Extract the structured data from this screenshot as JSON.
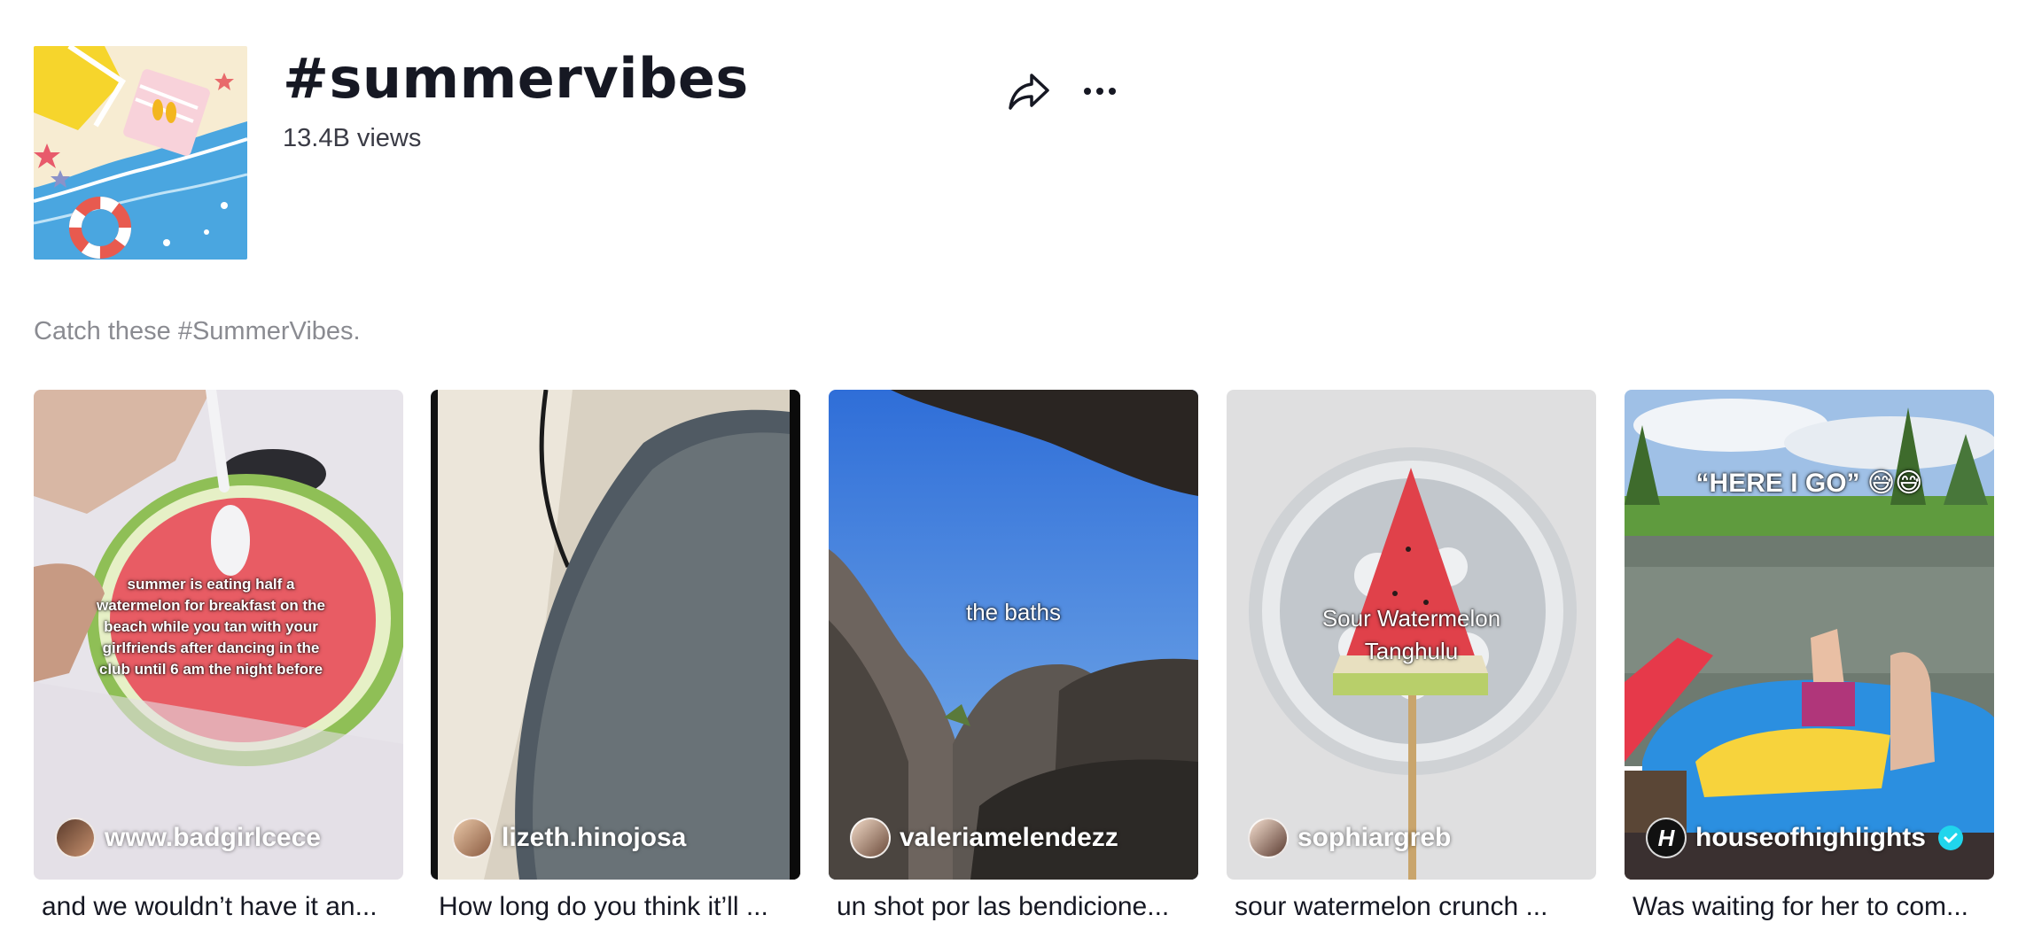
{
  "hashtag": {
    "title": "#summervibes",
    "views": "13.4B views",
    "description": "Catch these #SummerVibes.",
    "cover_icon": "beach-illustration"
  },
  "actions": {
    "share_icon": "share-arrow-icon",
    "more_icon": "ellipsis-icon"
  },
  "videos": [
    {
      "overlay": "summer is eating half a watermelon for breakfast on the beach while you tan with your girlfriends after dancing in the club until 6 am the night before",
      "author": "www.badgirlcece",
      "caption": "and we wouldn’t have it an...",
      "verified": false
    },
    {
      "overlay": "",
      "author": "lizeth.hinojosa",
      "caption": "How long do you think it’ll ...",
      "verified": false
    },
    {
      "overlay": "the baths",
      "author": "valeriamelendezz",
      "caption": "un shot por las bendicione...",
      "verified": false
    },
    {
      "overlay": "Sour Watermelon Tanghulu",
      "author": "sophiargreb",
      "caption": "sour watermelon crunch ...",
      "verified": false
    },
    {
      "overlay": "“HERE I GO” 😅😅",
      "author": "houseofhighlights",
      "caption": "Was waiting for her to com...",
      "verified": true
    }
  ],
  "colors": {
    "text_primary": "#161823",
    "text_secondary": "#8a8b91",
    "verified": "#20d5ec"
  }
}
